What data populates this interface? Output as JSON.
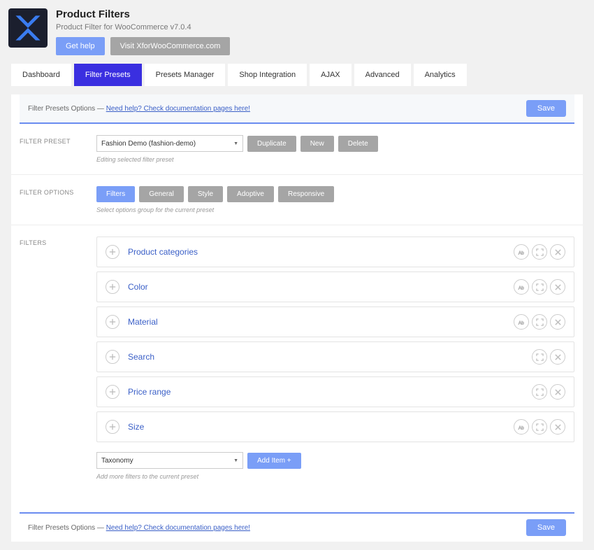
{
  "header": {
    "title": "Product Filters",
    "subtitle": "Product Filter for WooCommerce v7.0.4",
    "help_btn": "Get help",
    "visit_btn": "Visit XforWooCommerce.com"
  },
  "tabs": [
    "Dashboard",
    "Filter Presets",
    "Presets Manager",
    "Shop Integration",
    "AJAX",
    "Advanced",
    "Analytics"
  ],
  "active_tab": "Filter Presets",
  "optbar": {
    "prefix": "Filter Presets Options — ",
    "link": "Need help? Check documentation pages here!",
    "save": "Save"
  },
  "preset": {
    "label": "FILTER PRESET",
    "selected": "Fashion Demo (fashion-demo)",
    "duplicate": "Duplicate",
    "new": "New",
    "delete": "Delete",
    "hint": "Editing selected filter preset"
  },
  "options": {
    "label": "FILTER OPTIONS",
    "groups": [
      "Filters",
      "General",
      "Style",
      "Adoptive",
      "Responsive"
    ],
    "active": "Filters",
    "hint": "Select options group for the current preset"
  },
  "filters": {
    "label": "FILTERS",
    "items": [
      {
        "name": "Product categories",
        "actions": [
          "ab",
          "expand",
          "close"
        ]
      },
      {
        "name": "Color",
        "actions": [
          "ab",
          "expand",
          "close"
        ]
      },
      {
        "name": "Material",
        "actions": [
          "ab",
          "expand",
          "close"
        ]
      },
      {
        "name": "Search",
        "actions": [
          "expand",
          "close"
        ]
      },
      {
        "name": "Price range",
        "actions": [
          "expand",
          "close"
        ]
      },
      {
        "name": "Size",
        "actions": [
          "ab",
          "expand",
          "close"
        ]
      }
    ],
    "add_select": "Taxonomy",
    "add_btn": "Add Item +",
    "add_hint": "Add more filters to the current preset"
  }
}
